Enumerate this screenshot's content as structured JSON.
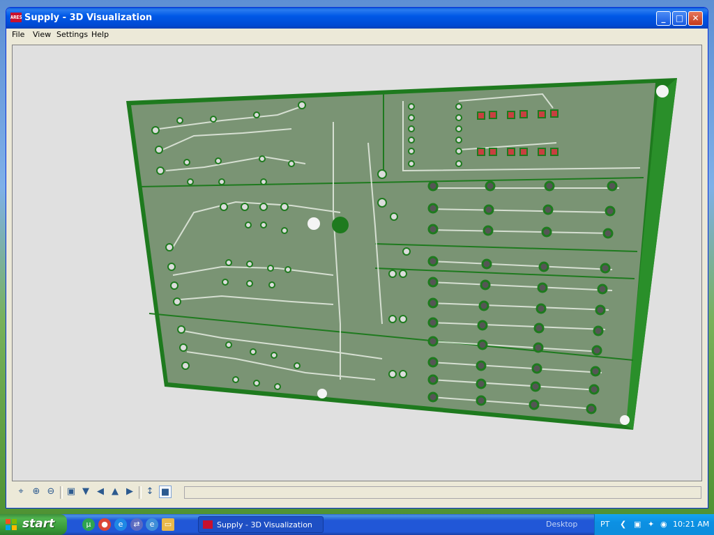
{
  "window": {
    "title": "Supply - 3D Visualization",
    "app_badge": "ARES"
  },
  "menubar": {
    "items": [
      "File",
      "View",
      "Settings",
      "Help"
    ]
  },
  "toolbar": {
    "tools": [
      "crosshair-icon",
      "zoom-in-icon",
      "zoom-out-icon",
      "view-top-icon",
      "view-front-icon",
      "view-left-icon",
      "view-back-icon",
      "view-right-icon",
      "height-icon",
      "component-icon"
    ]
  },
  "colors": {
    "board": "#1e7a1e",
    "board_surface": "#7a9474",
    "track": "#e0e8dc",
    "viewport_bg": "#e0e0e0"
  },
  "taskbar": {
    "start_label": "start",
    "task_label": "Supply - 3D Visualization",
    "desktop_label": "Desktop",
    "language": "PT",
    "clock": "10:21 AM"
  }
}
